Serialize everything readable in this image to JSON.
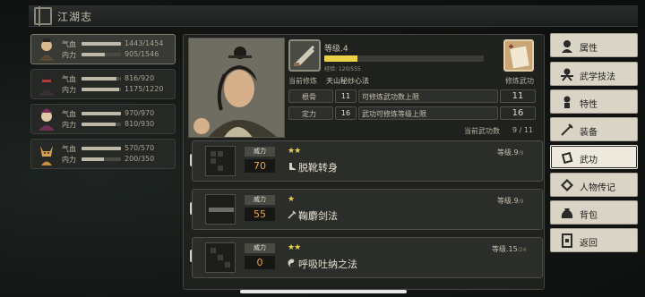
{
  "header": {
    "title": "江湖志"
  },
  "characters": [
    {
      "hp_label": "气血",
      "hp": "1443/1454",
      "hp_frac": 0.99,
      "mp_label": "内力",
      "mp": "905/1546",
      "mp_frac": 0.59
    },
    {
      "hp_label": "气血",
      "hp": "816/920",
      "hp_frac": 0.89,
      "mp_label": "内力",
      "mp": "1175/1220",
      "mp_frac": 0.96
    },
    {
      "hp_label": "气血",
      "hp": "970/970",
      "hp_frac": 1.0,
      "mp_label": "内力",
      "mp": "810/930",
      "mp_frac": 0.87
    },
    {
      "hp_label": "气血",
      "hp": "570/570",
      "hp_frac": 1.0,
      "mp_label": "内力",
      "mp": "200/350",
      "mp_frac": 0.57
    }
  ],
  "cultivation": {
    "current_label": "当前修炼",
    "current_name": "天山秘炒心法",
    "level_label": "等级",
    "level_value": ".4",
    "xp_text": "经验: 120/555",
    "xp_frac": 0.21,
    "cultivate_label": "修炼武功"
  },
  "attributes": [
    {
      "name": "根骨",
      "value": "11",
      "desc": "可修炼武功数上限",
      "limit": "11"
    },
    {
      "name": "定力",
      "value": "16",
      "desc": "武功可修炼等级上限",
      "limit": "16"
    }
  ],
  "current_skills_label": "当前武功数",
  "current_skills_count": "9 / 11",
  "skills": [
    {
      "index": "1",
      "power_label": "威力",
      "power": "70",
      "stars": "★★",
      "name": "脱靴转身",
      "type_icon": "boot-icon",
      "level_label": "等级",
      "level": ".9",
      "level_max": "/9"
    },
    {
      "index": "2",
      "power_label": "威力",
      "power": "55",
      "stars": "★",
      "name": "鞠麝剑法",
      "type_icon": "sword-icon",
      "level_label": "等级",
      "level": ".9",
      "level_max": "/9"
    },
    {
      "index": "3",
      "power_label": "威力",
      "power": "0",
      "stars": "★★",
      "name": "呼吸吐纳之法",
      "type_icon": "yinyang-icon",
      "level_label": "等级",
      "level": ".15",
      "level_max": "/24"
    }
  ],
  "menu": [
    {
      "label": "属性",
      "icon": "avatar-icon"
    },
    {
      "label": "武学技法",
      "icon": "martial-icon"
    },
    {
      "label": "特性",
      "icon": "trait-icon"
    },
    {
      "label": "装备",
      "icon": "weapon-icon"
    },
    {
      "label": "武功",
      "icon": "scroll-icon",
      "active": true
    },
    {
      "label": "人物传记",
      "icon": "biography-icon"
    },
    {
      "label": "背包",
      "icon": "bag-icon"
    },
    {
      "label": "返回",
      "icon": "return-icon"
    }
  ],
  "colors": {
    "accent_gold": "#e8d24a",
    "power_orange": "#eea538",
    "menu_bg": "#d9d4c5"
  }
}
